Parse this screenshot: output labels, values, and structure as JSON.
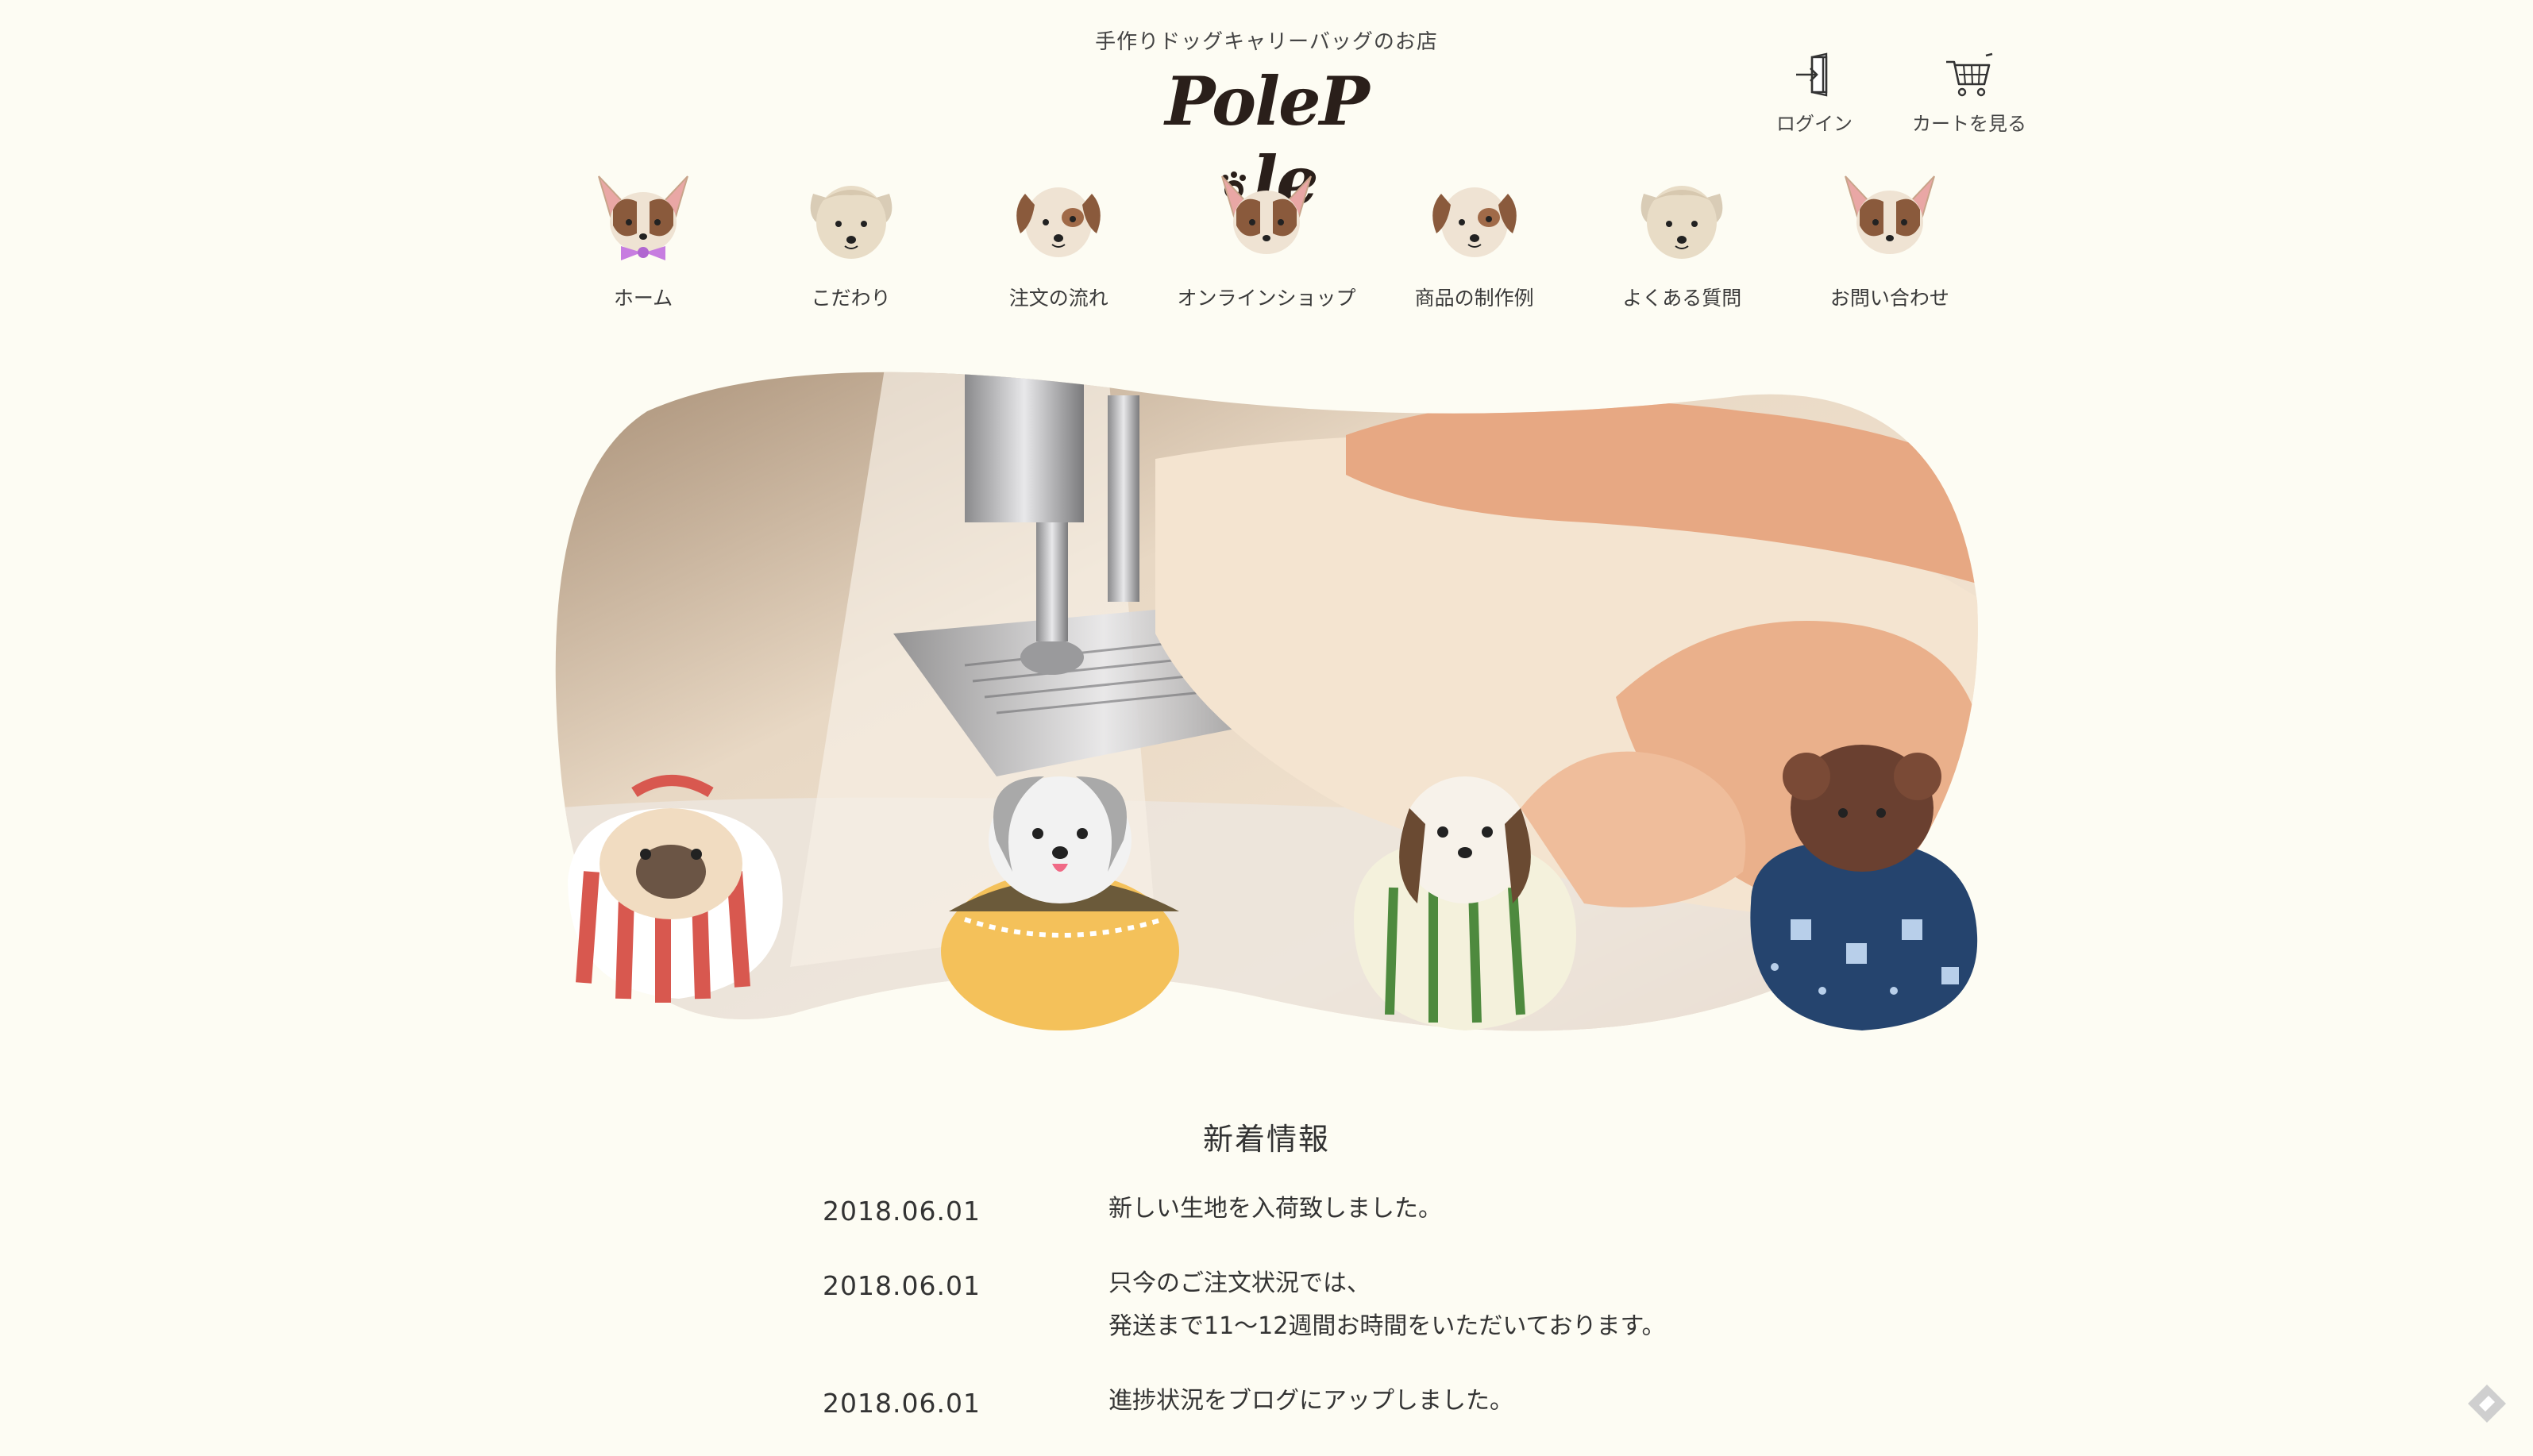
{
  "header": {
    "tagline": "手作りドッグキャリーバッグのお店",
    "logo_text_left": "Pole",
    "logo_text_p": "P",
    "logo_text_right": "le",
    "login_label": "ログイン",
    "cart_label": "カートを見る"
  },
  "nav": {
    "items": [
      {
        "label": "ホーム",
        "icon": "chihuahua-bowtie-icon"
      },
      {
        "label": "こだわり",
        "icon": "terrier-icon"
      },
      {
        "label": "注文の流れ",
        "icon": "beagle-icon"
      },
      {
        "label": "オンラインショップ",
        "icon": "chihuahua-icon"
      },
      {
        "label": "商品の制作例",
        "icon": "beagle-icon"
      },
      {
        "label": "よくある質問",
        "icon": "terrier-icon"
      },
      {
        "label": "お問い合わせ",
        "icon": "chihuahua-icon"
      }
    ]
  },
  "hero": {
    "alt_icons": [
      "pug-in-bag-icon",
      "shihtzu-in-bag-icon",
      "beagle-in-bag-icon",
      "poodle-in-bag-icon"
    ]
  },
  "news": {
    "title": "新着情報",
    "items": [
      {
        "date": "2018.06.01",
        "lines": [
          "新しい生地を入荷致しました。"
        ]
      },
      {
        "date": "2018.06.01",
        "lines": [
          "只今のご注文状況では、",
          "発送まで11〜12週間お時間をいただいております。"
        ]
      },
      {
        "date": "2018.06.01",
        "lines": [
          "進捗状況をブログにアップしました。"
        ]
      }
    ]
  },
  "colors": {
    "background": "#FDFCF3",
    "text": "#333333",
    "accent_bow": "#C77DE0"
  }
}
